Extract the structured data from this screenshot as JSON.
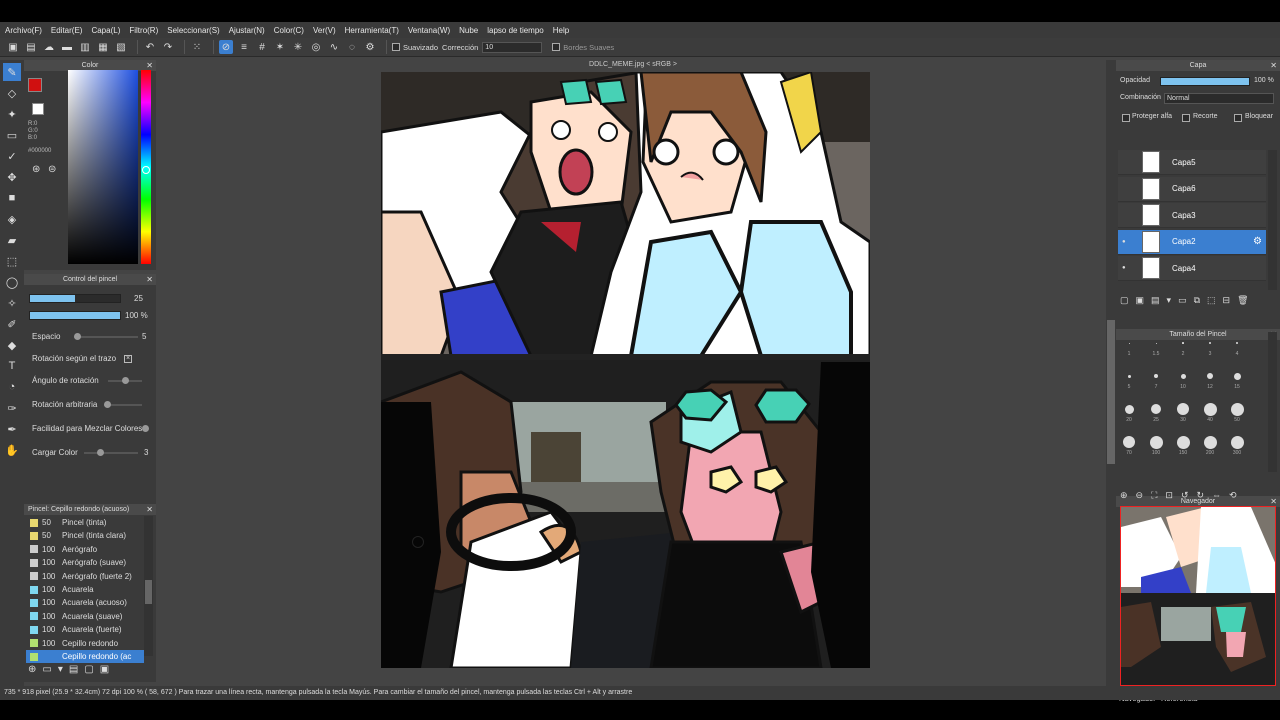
{
  "menu": [
    "Archivo(F)",
    "Editar(E)",
    "Capa(L)",
    "Filtro(R)",
    "Seleccionar(S)",
    "Ajustar(N)",
    "Color(C)",
    "Ver(V)",
    "Herramienta(T)",
    "Ventana(W)",
    "Nube",
    "lapso de tiempo",
    "Help"
  ],
  "toolbar": {
    "smooth_label": "Suavizado",
    "correction_label": "Corrección",
    "correction_value": "10",
    "soft_edges_label": "Bordes Suaves"
  },
  "color_panel": {
    "title": "Color",
    "r": "R:0",
    "g": "G:0",
    "b": "B:0",
    "hex": "#000000",
    "primary": "#d01010",
    "secondary": "#ffd700"
  },
  "brush_control": {
    "title": "Control del pincel",
    "size": "25",
    "opacity": "100 %",
    "size_fraction": 0.5,
    "spacing_label": "Espacio",
    "spacing_value": "5",
    "rotation_stroke_label": "Rotación según el trazo",
    "rotation_angle_label": "Ángulo de rotación",
    "rotation_random_label": "Rotación arbitraria",
    "blend_label": "Facilidad para Mezclar Colores",
    "load_label": "Cargar Color",
    "load_value": "3"
  },
  "brush_list": {
    "title": "Pincel: Cepillo redondo (acuoso)",
    "items": [
      {
        "size": "50",
        "name": "Pincel (tinta)",
        "color": "#e8d870"
      },
      {
        "size": "50",
        "name": "Pincel (tinta clara)",
        "color": "#e8d870"
      },
      {
        "size": "100",
        "name": "Aerógrafo",
        "color": "#cccccc"
      },
      {
        "size": "100",
        "name": "Aerógrafo (suave)",
        "color": "#cccccc"
      },
      {
        "size": "100",
        "name": "Aerógrafo (fuerte 2)",
        "color": "#cccccc"
      },
      {
        "size": "100",
        "name": "Acuarela",
        "color": "#7fd8f0"
      },
      {
        "size": "100",
        "name": "Acuarela (acuoso)",
        "color": "#7fd8f0"
      },
      {
        "size": "100",
        "name": "Acuarela (suave)",
        "color": "#7fd8f0"
      },
      {
        "size": "100",
        "name": "Acuarela (fuerte)",
        "color": "#7fd8f0"
      },
      {
        "size": "100",
        "name": "Cepillo redondo",
        "color": "#b0e070"
      },
      {
        "size": "",
        "name": "Cepillo redondo (ac",
        "color": "#b0e070"
      }
    ]
  },
  "canvas": {
    "title": "DDLC_MEME.jpg < sRGB >"
  },
  "layer_panel": {
    "title": "Capa",
    "opacity_label": "Opacidad",
    "opacity_value": "100 %",
    "blend_label": "Combinación",
    "blend_value": "Normal",
    "protect_alpha": "Proteger alfa",
    "clipping": "Recorte",
    "lock": "Bloquear",
    "layers": [
      "Capa5",
      "Capa6",
      "Capa3",
      "Capa2",
      "Capa4"
    ]
  },
  "brush_size_panel": {
    "title": "Tamaño del Pincel",
    "sizes": [
      "1",
      "1.5",
      "2",
      "3",
      "4",
      "5",
      "7",
      "10",
      "12",
      "15",
      "20",
      "25",
      "30",
      "40",
      "50",
      "70",
      "100",
      "150",
      "200",
      "300"
    ]
  },
  "navigator": {
    "title": "Navegador",
    "tabs": [
      "Navegador",
      "Referencia"
    ]
  },
  "status": "735 * 918 pixel  (25.9 * 32.4cm)  72 dpi   100 %   ( 58, 672 )    Para trazar una línea recta, mantenga pulsada la tecla Mayús. Para cambiar el tamaño del pincel, mantenga pulsada las teclas Ctrl + Alt y arrastre"
}
